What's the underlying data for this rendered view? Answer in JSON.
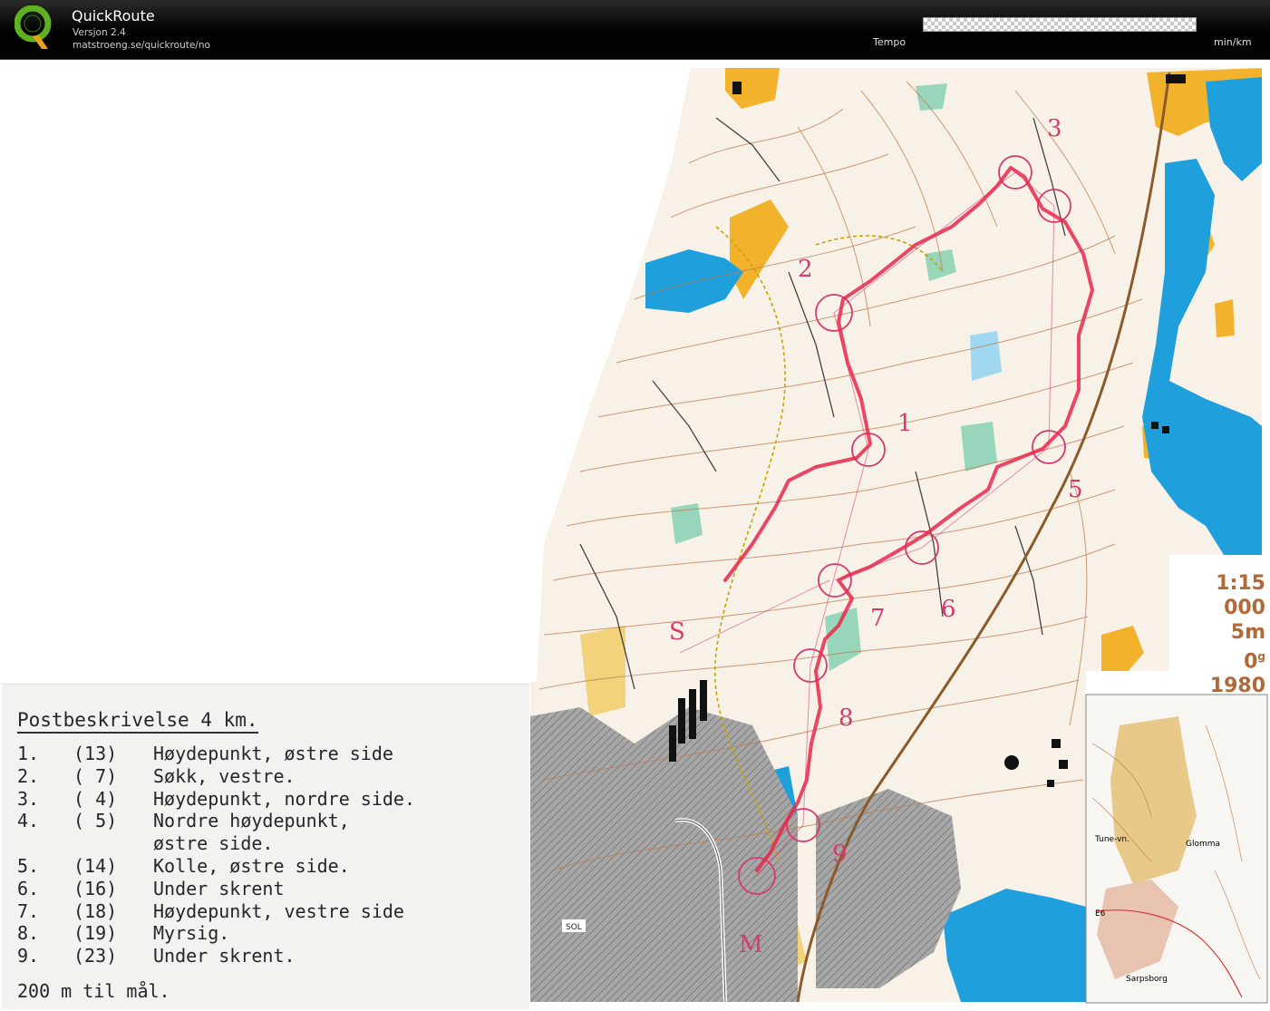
{
  "app": {
    "title": "QuickRoute",
    "version": "Versjon 2.4",
    "url": "matstroeng.se/quickroute/no",
    "tempo_label": "Tempo",
    "tempo_unit": "min/km"
  },
  "colors": {
    "route": "#e8284b",
    "controls": "#d43a6e",
    "water": "#1f9fdc",
    "open_land": "#f2b22c",
    "contours": "#c07a4c",
    "urban": "#9b9b9b",
    "header": "#000000"
  },
  "map_info": {
    "scale": "1:15 000",
    "contour_interval": "5m",
    "declination": "0",
    "declination_unit": "g",
    "year": "1980"
  },
  "inset_map": {
    "labels": [
      "Tune-vn.",
      "Glomma",
      "E6",
      "Sarpsborg"
    ]
  },
  "road_label": "SOL",
  "control_numbers": [
    "1",
    "2",
    "3",
    "4",
    "5",
    "6",
    "7",
    "8",
    "9",
    "S",
    "M"
  ],
  "control_description": {
    "title": "Postbeskrivelse 4 km.",
    "items": [
      {
        "num": "1.",
        "code": "(13)",
        "text": "Høydepunkt, østre side"
      },
      {
        "num": "2.",
        "code": "( 7)",
        "text": "Søkk, vestre."
      },
      {
        "num": "3.",
        "code": "( 4)",
        "text": "Høydepunkt, nordre side."
      },
      {
        "num": "4.",
        "code": "( 5)",
        "text": "Nordre høydepunkt,"
      },
      {
        "num": "",
        "code": "",
        "text": "østre side."
      },
      {
        "num": "5.",
        "code": "(14)",
        "text": "Kolle, østre side."
      },
      {
        "num": "6.",
        "code": "(16)",
        "text": "Under skrent"
      },
      {
        "num": "7.",
        "code": "(18)",
        "text": "Høydepunkt, vestre side"
      },
      {
        "num": "8.",
        "code": "(19)",
        "text": "Myrsig."
      },
      {
        "num": "9.",
        "code": "(23)",
        "text": "Under skrent."
      }
    ],
    "footer": "200 m til mål."
  }
}
